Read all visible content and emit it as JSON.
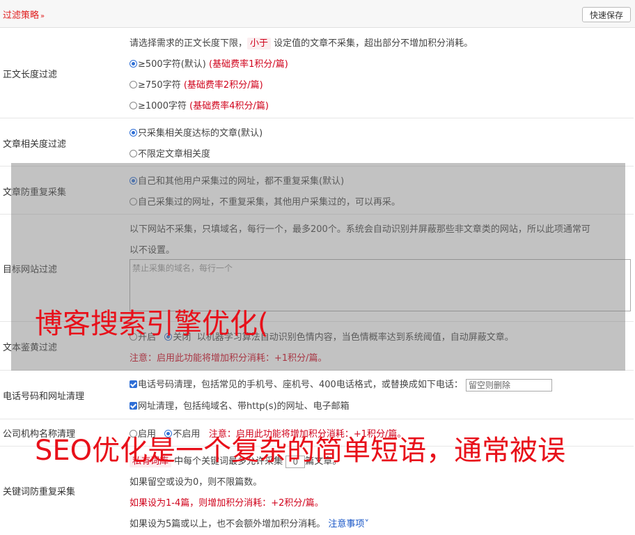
{
  "header": {
    "title": "过滤策略",
    "save_label": "快速保存"
  },
  "length_filter": {
    "label": "正文长度过滤",
    "desc_pre": "请选择需求的正文长度下限，",
    "desc_hl": "小于",
    "desc_post": "设定值的文章不采集，超出部分不增加积分消耗。",
    "options": [
      {
        "text": "≥500字符(默认)",
        "note": "(基础费率1积分/篇)",
        "selected": true
      },
      {
        "text": "≥750字符",
        "note": "(基础费率2积分/篇)",
        "selected": false
      },
      {
        "text": "≥1000字符",
        "note": "(基础费率4积分/篇)",
        "selected": false
      }
    ]
  },
  "relevance_filter": {
    "label": "文章相关度过滤",
    "options": [
      "只采集相关度达标的文章(默认)",
      "不限定文章相关度"
    ]
  },
  "dedup_filter": {
    "label": "文章防重复采集",
    "options": [
      "自己和其他用户采集过的网址，都不重复采集(默认)",
      "自己采集过的网址，不重复采集，其他用户采集过的，可以再采。"
    ]
  },
  "site_filter": {
    "label": "目标网站过滤",
    "desc1": "以下网站不采集，只填域名，每行一个，最多200个。系统会自动识别并屏蔽那些非文章类的网站，所以此项通常可",
    "desc2": "以不设置。",
    "placeholder": "禁止采集的域名，每行一个"
  },
  "porn_filter": {
    "label": "文本鉴黄过滤",
    "on": "开启",
    "off": "关闭",
    "desc": "以机器学习算法自动识别色情内容，当色情概率达到系统阈值，自动屏蔽文章。",
    "note": "注意：启用此功能将增加积分消耗：+1积分/篇。"
  },
  "phone_filter": {
    "label": "电话号码和网址清理",
    "phone_text": "电话号码清理，包括常见的手机号、座机号、400电话格式，或替换成如下电话：",
    "phone_placeholder": "留空则删除",
    "url_text": "网址清理，包括纯域名、带http(s)的网址、电子邮箱"
  },
  "org_filter": {
    "label": "公司机构名称清理",
    "on": "启用",
    "off": "不启用",
    "note": "注意：启用此功能将增加积分消耗：+1积分/篇。"
  },
  "keyword_dedup": {
    "label": "关键词防重复采集",
    "line1_hl": "私有词库",
    "line1_pre": "中每个关键词最多允许采集",
    "line1_value": "0",
    "line1_post": "篇文章。",
    "line2": "如果留空或设为0，则不限篇数。",
    "line3": "如果设为1-4篇，则增加积分消耗：+2积分/篇。",
    "line4": "如果设为5篇或以上，也不会额外增加积分消耗。",
    "line4_link": "注意事项"
  },
  "watermark": {
    "line1": "博客搜索引擎优化(",
    "line2": "SEO优化是一个复杂的简单短语，通常被误"
  }
}
